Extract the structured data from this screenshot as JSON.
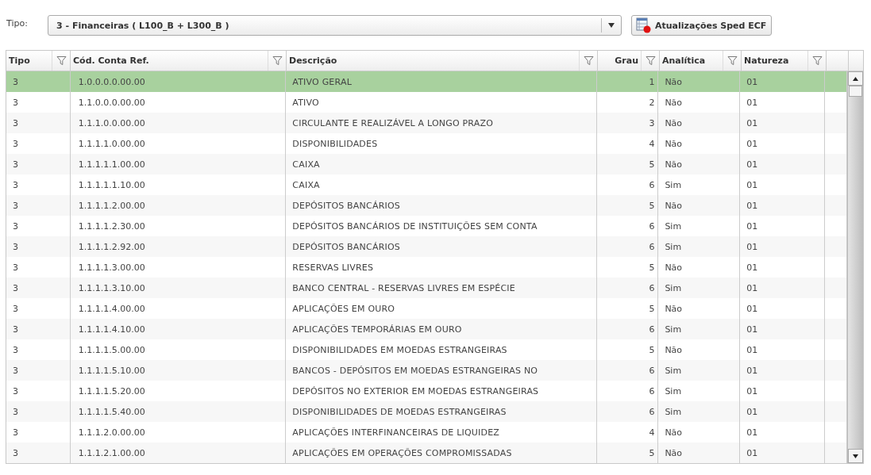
{
  "filter": {
    "label": "Tipo:",
    "value": "3 - Financeiras ( L100_B + L300_B )",
    "button": "Atualizações Sped ECF"
  },
  "table": {
    "columns": [
      {
        "label": "Tipo"
      },
      {
        "label": "Cód. Conta Ref."
      },
      {
        "label": "Descrição"
      },
      {
        "label": "Grau"
      },
      {
        "label": "Analítica"
      },
      {
        "label": "Natureza"
      }
    ],
    "rows": [
      {
        "cells": [
          "3",
          "1.0.0.0.0.00.00",
          "ATIVO GERAL",
          "1",
          "Não",
          "01"
        ],
        "selected": true
      },
      {
        "cells": [
          "3",
          "1.1.0.0.0.00.00",
          "ATIVO",
          "2",
          "Não",
          "01"
        ],
        "selected": false
      },
      {
        "cells": [
          "3",
          "1.1.1.0.0.00.00",
          "CIRCULANTE E REALIZÁVEL A LONGO PRAZO",
          "3",
          "Não",
          "01"
        ],
        "selected": false
      },
      {
        "cells": [
          "3",
          "1.1.1.1.0.00.00",
          "DISPONIBILIDADES",
          "4",
          "Não",
          "01"
        ],
        "selected": false
      },
      {
        "cells": [
          "3",
          "1.1.1.1.1.00.00",
          "CAIXA",
          "5",
          "Não",
          "01"
        ],
        "selected": false
      },
      {
        "cells": [
          "3",
          "1.1.1.1.1.10.00",
          "CAIXA",
          "6",
          "Sim",
          "01"
        ],
        "selected": false
      },
      {
        "cells": [
          "3",
          "1.1.1.1.2.00.00",
          "DEPÓSITOS BANCÁRIOS",
          "5",
          "Não",
          "01"
        ],
        "selected": false
      },
      {
        "cells": [
          "3",
          "1.1.1.1.2.30.00",
          "DEPÓSITOS BANCÁRIOS DE INSTITUIÇÕES SEM CONTA",
          "6",
          "Sim",
          "01"
        ],
        "selected": false
      },
      {
        "cells": [
          "3",
          "1.1.1.1.2.92.00",
          "DEPÓSITOS BANCÁRIOS",
          "6",
          "Sim",
          "01"
        ],
        "selected": false
      },
      {
        "cells": [
          "3",
          "1.1.1.1.3.00.00",
          "RESERVAS LIVRES",
          "5",
          "Não",
          "01"
        ],
        "selected": false
      },
      {
        "cells": [
          "3",
          "1.1.1.1.3.10.00",
          "BANCO CENTRAL - RESERVAS LIVRES EM ESPÉCIE",
          "6",
          "Sim",
          "01"
        ],
        "selected": false
      },
      {
        "cells": [
          "3",
          "1.1.1.1.4.00.00",
          "APLICAÇÕES EM OURO",
          "5",
          "Não",
          "01"
        ],
        "selected": false
      },
      {
        "cells": [
          "3",
          "1.1.1.1.4.10.00",
          "APLICAÇÕES TEMPORÁRIAS EM OURO",
          "6",
          "Sim",
          "01"
        ],
        "selected": false
      },
      {
        "cells": [
          "3",
          "1.1.1.1.5.00.00",
          "DISPONIBILIDADES EM MOEDAS ESTRANGEIRAS",
          "5",
          "Não",
          "01"
        ],
        "selected": false
      },
      {
        "cells": [
          "3",
          "1.1.1.1.5.10.00",
          "BANCOS - DEPÓSITOS EM MOEDAS ESTRANGEIRAS NO",
          "6",
          "Sim",
          "01"
        ],
        "selected": false
      },
      {
        "cells": [
          "3",
          "1.1.1.1.5.20.00",
          "DEPÓSITOS NO EXTERIOR EM MOEDAS ESTRANGEIRAS",
          "6",
          "Sim",
          "01"
        ],
        "selected": false
      },
      {
        "cells": [
          "3",
          "1.1.1.1.5.40.00",
          "DISPONIBILIDADES DE MOEDAS ESTRANGEIRAS",
          "6",
          "Sim",
          "01"
        ],
        "selected": false
      },
      {
        "cells": [
          "3",
          "1.1.1.2.0.00.00",
          "APLICAÇÕES INTERFINANCEIRAS DE LIQUIDEZ",
          "4",
          "Não",
          "01"
        ],
        "selected": false
      },
      {
        "cells": [
          "3",
          "1.1.1.2.1.00.00",
          "APLICAÇÕES EM OPERAÇÕES COMPROMISSADAS",
          "5",
          "Não",
          "01"
        ],
        "selected": false
      }
    ]
  }
}
